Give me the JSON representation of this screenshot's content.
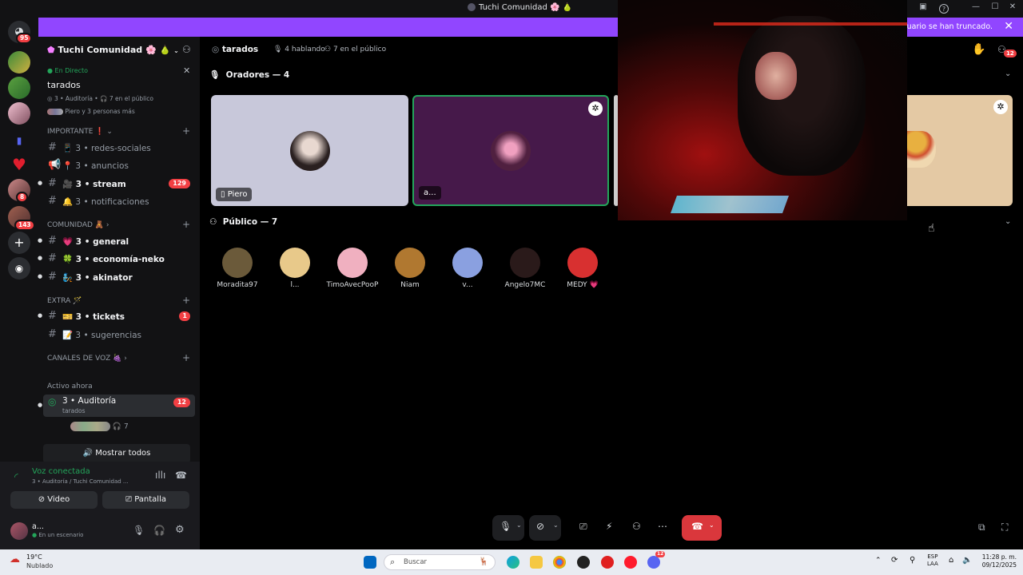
{
  "window": {
    "title": "Tuchi Comunidad 🌸 🍐"
  },
  "banner": {
    "text": "El modo Streamer está habilitado. Los nombres de usuario se han truncado."
  },
  "serverbar": {
    "badges": [
      "95",
      "8",
      "143"
    ]
  },
  "guild": {
    "name": "Tuchi Comunidad 🌸 🍐"
  },
  "live": {
    "status": "En Directo",
    "stage_title": "tarados",
    "stage_meta": "3 • Auditoría • 🎧 7 en el público",
    "participants": "Piero y 3 personas más"
  },
  "categories": {
    "importante": "IMPORTANTE",
    "comunidad": "COMUNIDAD 🧸",
    "extra": "EXTRA 🪄",
    "voz": "CANALES DE VOZ 🍇",
    "activo": "Activo ahora"
  },
  "channels": [
    {
      "label": "3 • redes-sociales",
      "emoji": "📱"
    },
    {
      "label": "3 • anuncios",
      "emoji": "📍"
    },
    {
      "label": "3 • stream",
      "emoji": "🎥",
      "badge": "129"
    },
    {
      "label": "3 • notificaciones",
      "emoji": "🔔"
    },
    {
      "label": "3 • general",
      "emoji": "💗"
    },
    {
      "label": "3 • economía-neko",
      "emoji": "🍀"
    },
    {
      "label": "3 • akinator",
      "emoji": "🧞"
    },
    {
      "label": "3 • tickets",
      "emoji": "🎫",
      "badge": "1"
    },
    {
      "label": "3 • sugerencias",
      "emoji": "📝"
    }
  ],
  "active_now": {
    "channel": "3 • Auditoría",
    "sub": "tarados",
    "badge": "12",
    "listeners": "7"
  },
  "show_all": "Mostrar todos",
  "voice": {
    "status": "Voz conectada",
    "location": "3 • Auditoría / Tuchi Comunidad ...",
    "video_btn": "Video",
    "screen_btn": "Pantalla",
    "user": "a...",
    "user_status": "En un escenario"
  },
  "stage_header": {
    "title": "tarados",
    "speaking": "4 hablando",
    "audience": "7 en el público",
    "inbox_badge": "12"
  },
  "speakers": {
    "heading": "Oradores — 4",
    "tiles": [
      {
        "name": "Piero",
        "bg": "#c8c8da"
      },
      {
        "name": "a...",
        "bg": "#46194a"
      },
      {
        "name": "",
        "bg": "#e4c9a4"
      }
    ]
  },
  "audience": {
    "heading": "Público — 7",
    "members": [
      {
        "name": "Moradita97",
        "color": "#6b5a3a"
      },
      {
        "name": "l...",
        "color": "#e8c98a"
      },
      {
        "name": "TimoAvecPooP",
        "color": "#f0b0c0"
      },
      {
        "name": "Niam",
        "color": "#b07830"
      },
      {
        "name": "v...",
        "color": "#8aa0e0"
      },
      {
        "name": "Angelo7MC",
        "color": "#2a1a1a"
      },
      {
        "name": "MEDY 💗",
        "color": "#d83030"
      }
    ]
  },
  "taskbar": {
    "weather_temp": "19°C",
    "weather_desc": "Nublado",
    "search": "Buscar",
    "lang1": "ESP",
    "lang2": "LAA",
    "time": "11:28 p. m.",
    "date": "09/12/2025",
    "discord_badge": "12"
  }
}
